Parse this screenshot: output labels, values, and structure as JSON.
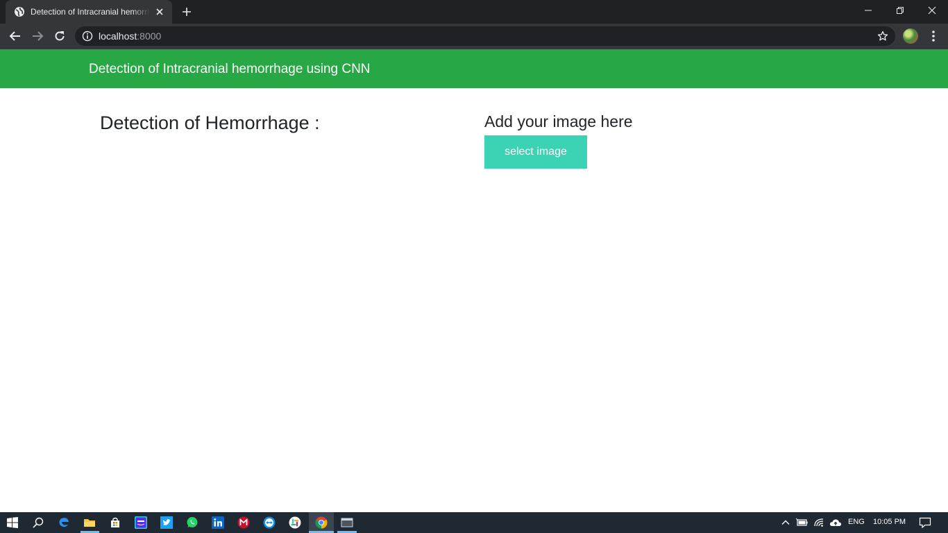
{
  "browser": {
    "tab": {
      "title": "Detection of Intracranial hemorrhage using CNN"
    },
    "address": {
      "host": "localhost",
      "port": ":8000"
    },
    "colors": {
      "frame": "#202124",
      "toolbar": "#35363a"
    }
  },
  "page": {
    "navbar": {
      "brand": "Detection of Intracranial hemorrhage using CNN",
      "color": "#28a745"
    },
    "left_heading": "Detection of Hemorrhage :",
    "upload": {
      "heading": "Add your image here",
      "button_label": "select image",
      "button_color": "#3bd3b3"
    }
  },
  "taskbar": {
    "apps": [
      "windows-start-icon",
      "search-icon",
      "edge-icon",
      "file-explorer-icon",
      "store-icon",
      "amazon-music-icon",
      "twitter-icon",
      "whatsapp-icon",
      "linkedin-icon",
      "mcafee-icon",
      "teamviewer-icon",
      "slack-icon",
      "chrome-icon",
      "terminal-icon"
    ],
    "tray": {
      "language": "ENG",
      "time": "10:05 PM"
    }
  }
}
